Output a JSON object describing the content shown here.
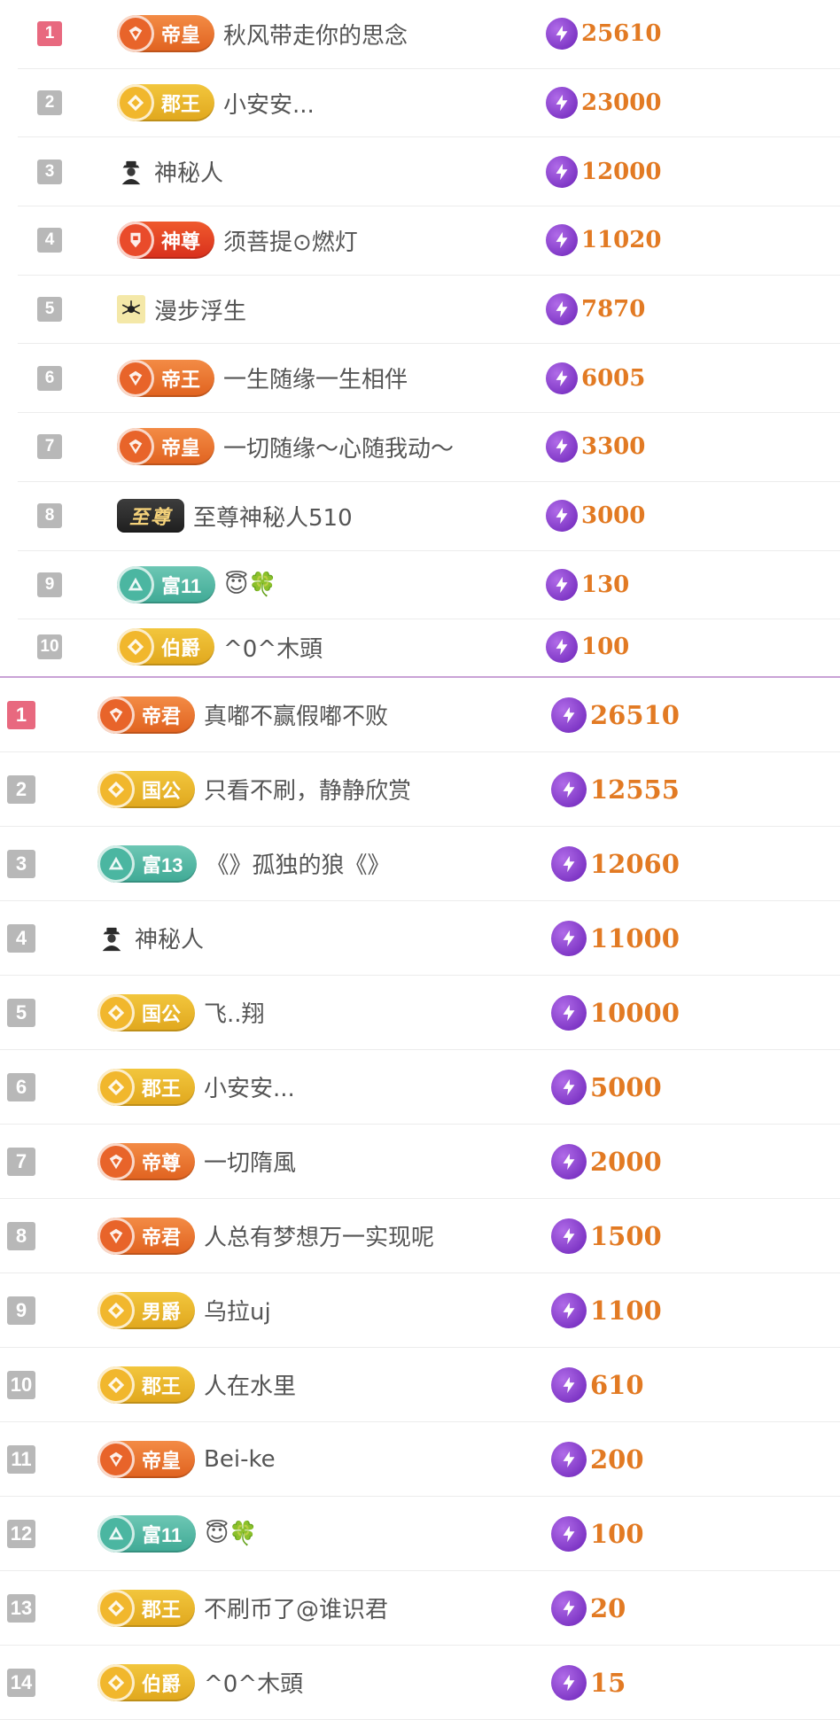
{
  "boards": [
    {
      "rows": [
        {
          "rank": "1",
          "badge": "帝皇",
          "badge_style": "orange",
          "name": "秋风带走你的思念",
          "score": "25610"
        },
        {
          "rank": "2",
          "badge": "郡王",
          "badge_style": "gold",
          "name": "小安安...",
          "score": "23000"
        },
        {
          "rank": "3",
          "badge": "",
          "badge_style": "mystery",
          "name": "神秘人",
          "score": "12000"
        },
        {
          "rank": "4",
          "badge": "神尊",
          "badge_style": "red",
          "name": "须菩提⊙燃灯",
          "score": "11020"
        },
        {
          "rank": "5",
          "badge": "",
          "badge_style": "avatar",
          "name": "漫步浮生",
          "score": "7870"
        },
        {
          "rank": "6",
          "badge": "帝王",
          "badge_style": "orange",
          "name": "一生随缘一生相伴",
          "score": "6005"
        },
        {
          "rank": "7",
          "badge": "帝皇",
          "badge_style": "orange",
          "name": "一切随缘～心随我动～",
          "score": "3300"
        },
        {
          "rank": "8",
          "badge": "至尊",
          "badge_style": "dark",
          "name": "至尊神秘人510",
          "score": "3000"
        },
        {
          "rank": "9",
          "badge": "富11",
          "badge_style": "teal",
          "name": "😇🍀",
          "score": "130"
        },
        {
          "rank": "10",
          "badge": "伯爵",
          "badge_style": "gold",
          "name": "^0^木頭",
          "score": "100"
        }
      ]
    },
    {
      "rows": [
        {
          "rank": "1",
          "badge": "帝君",
          "badge_style": "orange",
          "name": "真嘟不赢假嘟不败",
          "score": "26510"
        },
        {
          "rank": "2",
          "badge": "国公",
          "badge_style": "gold",
          "name": "只看不刷，静静欣赏",
          "score": "12555"
        },
        {
          "rank": "3",
          "badge": "富13",
          "badge_style": "teal",
          "name": "《》孤独的狼《》",
          "score": "12060"
        },
        {
          "rank": "4",
          "badge": "",
          "badge_style": "mystery",
          "name": "神秘人",
          "score": "11000"
        },
        {
          "rank": "5",
          "badge": "国公",
          "badge_style": "gold",
          "name": "飞..翔",
          "score": "10000"
        },
        {
          "rank": "6",
          "badge": "郡王",
          "badge_style": "gold",
          "name": "小安安...",
          "score": "5000"
        },
        {
          "rank": "7",
          "badge": "帝尊",
          "badge_style": "orange",
          "name": "一切隋風",
          "score": "2000"
        },
        {
          "rank": "8",
          "badge": "帝君",
          "badge_style": "orange",
          "name": "人总有梦想万一实现呢",
          "score": "1500"
        },
        {
          "rank": "9",
          "badge": "男爵",
          "badge_style": "gold",
          "name": "乌拉uj",
          "score": "1100"
        },
        {
          "rank": "10",
          "badge": "郡王",
          "badge_style": "gold",
          "name": "人在水里",
          "score": "610"
        },
        {
          "rank": "11",
          "badge": "帝皇",
          "badge_style": "orange",
          "name": "Bei-ke",
          "score": "200"
        },
        {
          "rank": "12",
          "badge": "富11",
          "badge_style": "teal",
          "name": "😇🍀",
          "score": "100"
        },
        {
          "rank": "13",
          "badge": "郡王",
          "badge_style": "gold",
          "name": "不刷币了@谁识君",
          "score": "20"
        },
        {
          "rank": "14",
          "badge": "伯爵",
          "badge_style": "gold",
          "name": "^0^木頭",
          "score": "15"
        }
      ]
    }
  ],
  "colors": {
    "rank_top": "#e8697f",
    "rank_default": "#b8b8b8",
    "score_text": "#e27a23",
    "bolt": "#7b2fc4",
    "divider": "#c9a3d6"
  },
  "icons": {
    "score": "lightning-bolt-icon",
    "mystery": "mystery-person-icon",
    "avatar": "spider-avatar-icon"
  }
}
